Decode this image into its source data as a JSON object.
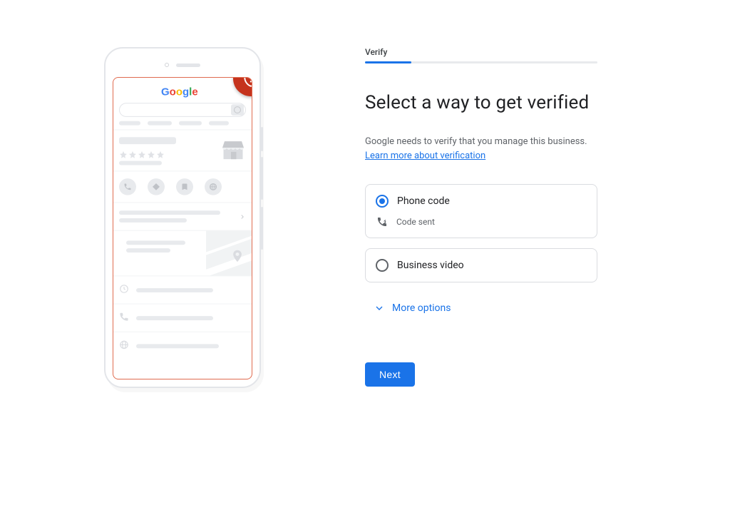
{
  "progress": {
    "step_label": "Verify",
    "percent": 20
  },
  "heading": "Select a way to get verified",
  "subtitle": "Google needs to verify that you manage this business.",
  "learn_more": "Learn more about verification",
  "options": {
    "phone": {
      "title": "Phone code",
      "status": "Code sent",
      "selected": true
    },
    "video": {
      "title": "Business video",
      "selected": false
    }
  },
  "more_options_label": "More options",
  "next_button": "Next",
  "illustration": {
    "logo": "Google",
    "badge_icon": "shield-alert-icon"
  }
}
